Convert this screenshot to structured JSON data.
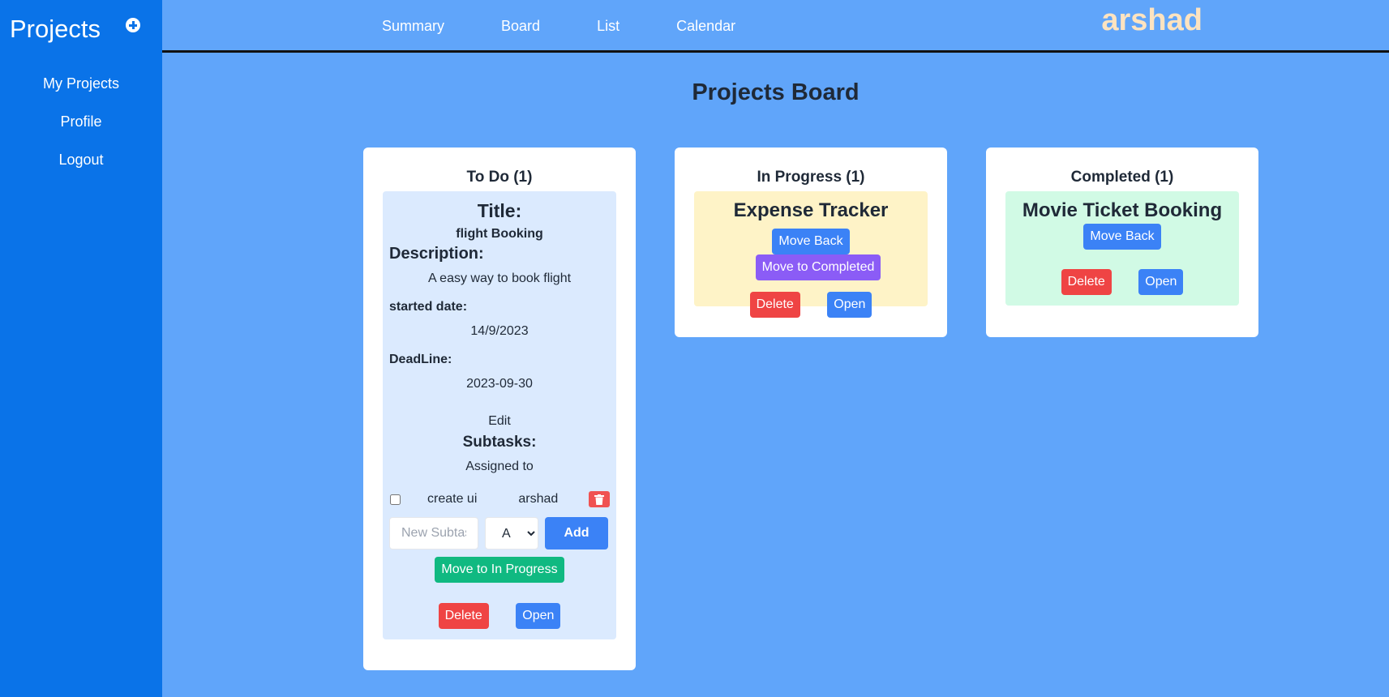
{
  "sidebar": {
    "title": "Projects",
    "add_icon": "plus-circle-icon",
    "items": [
      {
        "label": "My Projects"
      },
      {
        "label": "Profile"
      },
      {
        "label": "Logout"
      }
    ]
  },
  "topnav": {
    "items": [
      {
        "label": "Summary"
      },
      {
        "label": "Board"
      },
      {
        "label": "List"
      },
      {
        "label": "Calendar"
      }
    ],
    "username": "arshad"
  },
  "page_title": "Projects Board",
  "colors": {
    "background": "#60a5fa",
    "sidebar": "#0a73e8",
    "username": "#fde3c0",
    "todo_card": "#dbeafe",
    "progress_card": "#fef3c7",
    "done_card": "#d1fae5",
    "blue_button": "#3b82f6",
    "red_button": "#ef4444",
    "green_button": "#10b981",
    "purple_button": "#8b5cf6"
  },
  "columns": {
    "todo": {
      "header": "To Do (1)",
      "card": {
        "title_label": "Title:",
        "title": "flight Booking",
        "description_label": "Description:",
        "description": "A easy way to book flight",
        "started_label": "started date:",
        "started": "14/9/2023",
        "deadline_label": "DeadLine:",
        "deadline": "2023-09-30",
        "edit_label": "Edit",
        "subtasks_label": "Subtasks:",
        "assigned_label": "Assigned to",
        "subtasks": [
          {
            "name": "create ui",
            "assignee": "arshad",
            "checked": false
          }
        ],
        "new_subtask_placeholder": "New Subtask",
        "assignee_select_value": "A",
        "add_label": "Add",
        "move_label": "Move to In Progress",
        "delete_label": "Delete",
        "open_label": "Open"
      }
    },
    "in_progress": {
      "header": "In Progress (1)",
      "card": {
        "title": "Expense Tracker",
        "move_back_label": "Move Back",
        "move_forward_label": "Move to Completed",
        "delete_label": "Delete",
        "open_label": "Open"
      }
    },
    "completed": {
      "header": "Completed (1)",
      "card": {
        "title": "Movie Ticket Booking",
        "move_back_label": "Move Back",
        "delete_label": "Delete",
        "open_label": "Open"
      }
    }
  }
}
